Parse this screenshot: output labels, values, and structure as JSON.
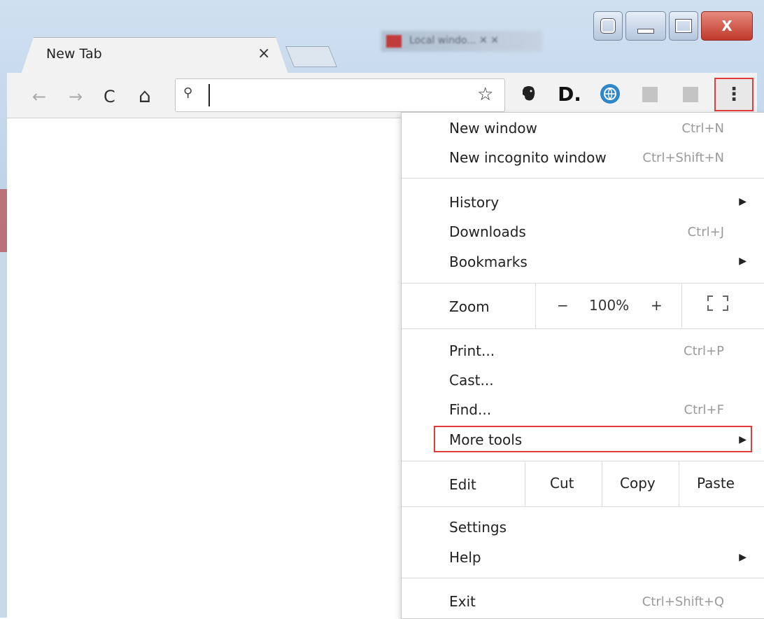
{
  "tab": {
    "title": "New Tab",
    "close": "×"
  },
  "background_tab": {
    "label": "Local windo... ✕ ✕"
  },
  "toolbar": {
    "back": "←",
    "forward": "→",
    "reload": "C",
    "home": "⌂",
    "search_glyph": "⚲",
    "star": "☆",
    "menu_glyph": "⋮",
    "ext_d": "D."
  },
  "menu": {
    "new_window": {
      "label": "New window",
      "shortcut": "Ctrl+N"
    },
    "new_incognito": {
      "label": "New incognito window",
      "shortcut": "Ctrl+Shift+N"
    },
    "history": {
      "label": "History"
    },
    "downloads": {
      "label": "Downloads",
      "shortcut": "Ctrl+J"
    },
    "bookmarks": {
      "label": "Bookmarks"
    },
    "zoom": {
      "label": "Zoom",
      "minus": "−",
      "value": "100%",
      "plus": "+"
    },
    "print": {
      "label": "Print...",
      "shortcut": "Ctrl+P"
    },
    "cast": {
      "label": "Cast..."
    },
    "find": {
      "label": "Find...",
      "shortcut": "Ctrl+F"
    },
    "more_tools": {
      "label": "More tools"
    },
    "edit": {
      "label": "Edit",
      "cut": "Cut",
      "copy": "Copy",
      "paste": "Paste"
    },
    "settings": {
      "label": "Settings"
    },
    "help": {
      "label": "Help"
    },
    "exit": {
      "label": "Exit",
      "shortcut": "Ctrl+Shift+Q"
    },
    "submenu_arrow": "▶"
  },
  "colors": {
    "highlight": "#e23b3b",
    "shortcut_text": "#9a9a9a"
  }
}
